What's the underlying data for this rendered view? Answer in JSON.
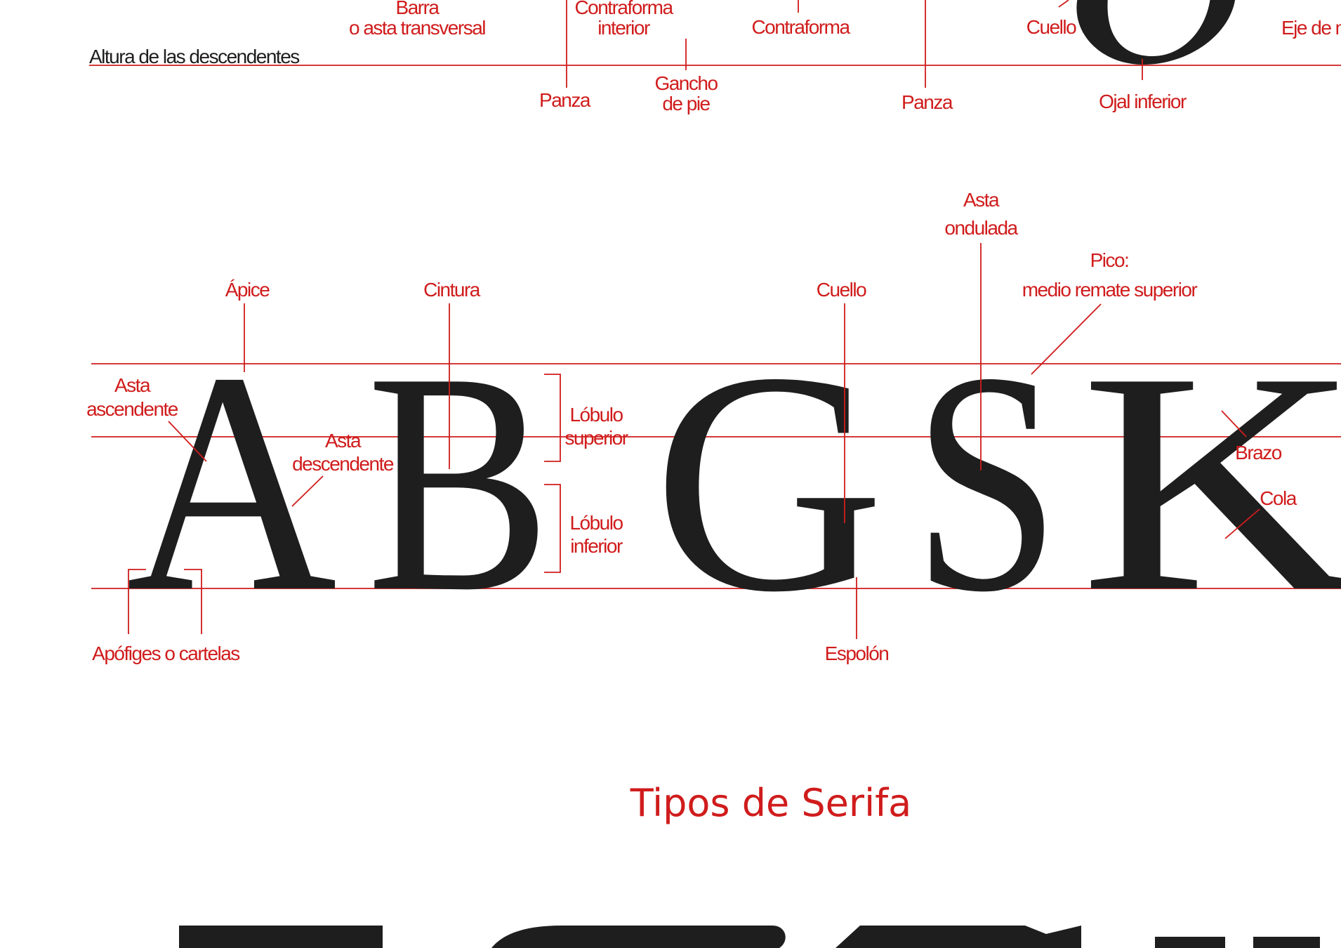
{
  "colors": {
    "accent": "#d01c1c",
    "ink": "#1e1e1e",
    "background": "#ffffff"
  },
  "top": {
    "baseline_label": "Altura de las descendentes",
    "barra": [
      "Barra",
      "o asta transversal"
    ],
    "contraforma_interior": [
      "Contraforma",
      "interior"
    ],
    "contraforma": "Contraforma",
    "cuello": "Cuello",
    "eje": "Eje de m",
    "panza_1": "Panza",
    "gancho": [
      "Gancho",
      "de pie"
    ],
    "panza_2": "Panza",
    "ojal_inferior": "Ojal inferior"
  },
  "middle": {
    "letters": [
      "A",
      "B",
      "G",
      "S",
      "K"
    ],
    "apice": "Ápice",
    "cintura": "Cintura",
    "cuello": "Cuello",
    "asta_ondulada": [
      "Asta",
      "ondulada"
    ],
    "pico": [
      "Pico:",
      "medio remate superior"
    ],
    "asta_ascendente": [
      "Asta",
      "ascendente"
    ],
    "asta_descendente": [
      "Asta",
      "descendente"
    ],
    "lobulo_superior": [
      "Lóbulo",
      "superior"
    ],
    "lobulo_inferior": [
      "Lóbulo",
      "inferior"
    ],
    "brazo": "Brazo",
    "cola": "Cola",
    "apofiges": "Apófiges o cartelas",
    "espolon": "Espolón"
  },
  "section_title": "Tipos de Serifa"
}
